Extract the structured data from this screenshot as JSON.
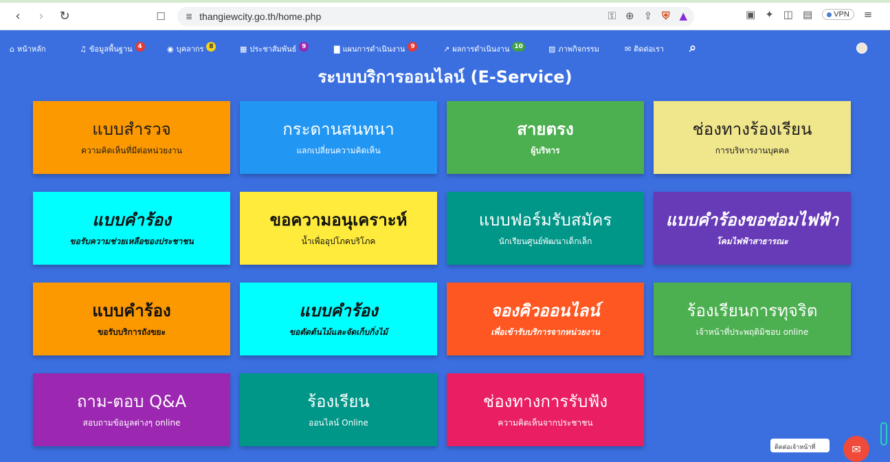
{
  "browser": {
    "url": "thangiewcity.go.th/home.php",
    "vpn_label": "VPN",
    "icons": [
      "back-icon",
      "forward-icon",
      "reload-icon",
      "bookmark-icon",
      "site-info-icon",
      "key-icon",
      "zoom-icon",
      "share-icon",
      "brave-shield-icon",
      "brave-rewards-icon",
      "extension-icon",
      "puzzle-icon",
      "sidebar-icon",
      "wallet-icon",
      "menu-icon"
    ]
  },
  "nav": {
    "items": [
      {
        "icon": "home-icon",
        "label": "หน้าหลัก",
        "badge": ""
      },
      {
        "icon": "bell-icon",
        "label": "ข้อมูลพื้นฐาน",
        "badge": "4",
        "badge_color": "#e53935"
      },
      {
        "icon": "user-circle-icon",
        "label": "บุคลากร",
        "badge": "8",
        "badge_color": "#f6d21a"
      },
      {
        "icon": "newspaper-icon",
        "label": "ประชาสัมพันธ์",
        "badge": "9",
        "badge_color": "#9c27b0"
      },
      {
        "icon": "chart-icon",
        "label": "แผนการดำเนินงาน",
        "badge": "9",
        "badge_color": "#e53935"
      },
      {
        "icon": "line-chart-icon",
        "label": "ผลการดำเนินงาน",
        "badge": "10",
        "badge_color": "#43a047"
      },
      {
        "icon": "image-icon",
        "label": "ภาพกิจกรรม",
        "badge": ""
      },
      {
        "icon": "envelope-icon",
        "label": "ติดต่อเรา",
        "badge": ""
      }
    ]
  },
  "heading": "ระบบบริการออนไลน์ (E-Service)",
  "cards": [
    {
      "title": "แบบสำรวจ",
      "subtitle": "ความคิดเห็นที่มีต่อหน่วยงาน",
      "bg": "#fd9900",
      "color": "#1b1b1b"
    },
    {
      "title": "กระดานสนทนา",
      "subtitle": "แลกเปลี่ยนความคิดเห็น",
      "bg": "#2196f3",
      "color": "#ffffff"
    },
    {
      "title": "สายตรง",
      "subtitle": "ผู้บริหาร",
      "bg": "#4caf50",
      "color": "#ffffff"
    },
    {
      "title": "ช่องทางร้องเรียน",
      "subtitle": "การบริหารงานบุคคล",
      "bg": "#f0e68c",
      "color": "#1b1b1b"
    },
    {
      "title": "แบบคำร้อง",
      "subtitle": "ขอรับความช่วยเหลือของประชาชน",
      "bg": "#00ffff",
      "color": "#111111"
    },
    {
      "title": "ขอความอนุเคราะห์",
      "subtitle": "น้ำเพื่ออุปโภคบริโภค",
      "bg": "#ffeb3b",
      "color": "#111111"
    },
    {
      "title": "แบบฟอร์มรับสมัคร",
      "subtitle": "นักเรียนศูนย์พัฒนาเด็กเล็ก",
      "bg": "#009688",
      "color": "#ffffff"
    },
    {
      "title": "แบบคำร้องขอซ่อมไฟฟ้า",
      "subtitle": "โคมไฟฟ้าสาธารณะ",
      "bg": "#673ab7",
      "color": "#ffffff"
    },
    {
      "title": "แบบคำร้อง",
      "subtitle": "ขอรับบริการถังขยะ",
      "bg": "#fd9900",
      "color": "#111111"
    },
    {
      "title": "แบบคำร้อง",
      "subtitle": "ขอตัดต้นไม้และจัดเก็บกิ่งไม้",
      "bg": "#00ffff",
      "color": "#111111"
    },
    {
      "title": "จองคิวออนไลน์",
      "subtitle": "เพื่อเข้ารับบริการจากหน่วยงาน",
      "bg": "#ff5722",
      "color": "#ffffff"
    },
    {
      "title": "ร้องเรียนการทุจริต",
      "subtitle": "เจ้าหน้าที่ประพฤติมิชอบ online",
      "bg": "#4caf50",
      "color": "#ffffff"
    },
    {
      "title": "ถาม-ตอบ Q&A",
      "subtitle": "สอบถามข้อมูลต่างๆ online",
      "bg": "#9c27b0",
      "color": "#ffffff"
    },
    {
      "title": "ร้องเรียน",
      "subtitle": "ออนไลน์ Online",
      "bg": "#009688",
      "color": "#ffffff"
    },
    {
      "title": "ช่องทางการรับฟัง",
      "subtitle": "ความคิดเห็นจากประชาชน",
      "bg": "#e91e63",
      "color": "#ffffff"
    }
  ],
  "chat": {
    "tooltip": "ติดต่อเจ้าหน้าที่"
  }
}
